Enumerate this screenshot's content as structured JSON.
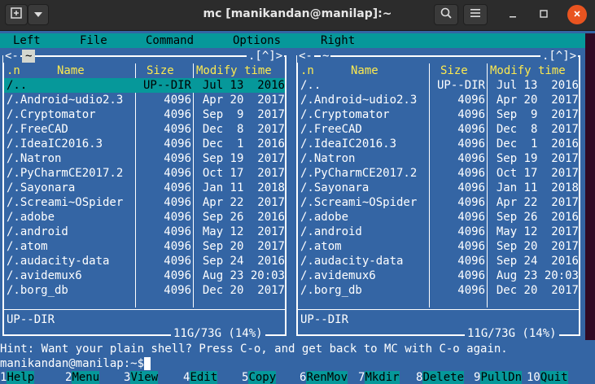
{
  "window": {
    "title": "mc [manikandan@manilap]:~",
    "new_tab_icon": "terminal-add-icon",
    "menu_icon": "chevron-down-icon"
  },
  "menubar": [
    "Left",
    "File",
    "Command",
    "Options",
    "Right"
  ],
  "left_panel": {
    "top_left": "<-",
    "dir": "~",
    "top_right": ".[^]>",
    "headers": {
      "name_prefix": ".n",
      "name": "Name",
      "size": "Size",
      "time": "Modify time"
    },
    "footer_info": "UP--DIR",
    "disk": "11G/73G (14%)"
  },
  "right_panel": {
    "top_left": "<-",
    "dir": "~",
    "top_right": ".[^]>",
    "headers": {
      "name_prefix": ".n",
      "name": "Name",
      "size": "Size",
      "time": "Modify time"
    },
    "footer_info": "UP--DIR",
    "disk": "11G/73G (14%)"
  },
  "files": [
    {
      "name": "/..",
      "size": "UP--DIR",
      "time": "Jul 13  2016"
    },
    {
      "name": "/.Android~udio2.3",
      "size": "4096",
      "time": "Apr 20  2017"
    },
    {
      "name": "/.Cryptomator",
      "size": "4096",
      "time": "Sep  9  2017"
    },
    {
      "name": "/.FreeCAD",
      "size": "4096",
      "time": "Dec  8  2017"
    },
    {
      "name": "/.IdeaIC2016.3",
      "size": "4096",
      "time": "Dec  1  2016"
    },
    {
      "name": "/.Natron",
      "size": "4096",
      "time": "Sep 19  2017"
    },
    {
      "name": "/.PyCharmCE2017.2",
      "size": "4096",
      "time": "Oct 17  2017"
    },
    {
      "name": "/.Sayonara",
      "size": "4096",
      "time": "Jan 11  2018"
    },
    {
      "name": "/.Screami~OSpider",
      "size": "4096",
      "time": "Apr 22  2017"
    },
    {
      "name": "/.adobe",
      "size": "4096",
      "time": "Sep 26  2016"
    },
    {
      "name": "/.android",
      "size": "4096",
      "time": "May 12  2017"
    },
    {
      "name": "/.atom",
      "size": "4096",
      "time": "Sep 20  2017"
    },
    {
      "name": "/.audacity-data",
      "size": "4096",
      "time": "Sep 24  2016"
    },
    {
      "name": "/.avidemux6",
      "size": "4096",
      "time": "Aug 23 20:03"
    },
    {
      "name": "/.borg_db",
      "size": "4096",
      "time": "Dec 20  2017"
    }
  ],
  "hint": "Hint: Want your plain shell? Press C-o, and get back to MC with C-o again.",
  "prompt": "manikandan@manilap:~$",
  "fkeys": [
    {
      "num": "1",
      "label": "Help"
    },
    {
      "num": "2",
      "label": "Menu"
    },
    {
      "num": "3",
      "label": "View"
    },
    {
      "num": "4",
      "label": "Edit"
    },
    {
      "num": "5",
      "label": "Copy"
    },
    {
      "num": "6",
      "label": "RenMov"
    },
    {
      "num": "7",
      "label": "Mkdir"
    },
    {
      "num": "8",
      "label": "Delete"
    },
    {
      "num": "9",
      "label": "PullDn"
    },
    {
      "num": "10",
      "label": "Quit"
    }
  ],
  "colors": {
    "panel_bg": "#3465a4",
    "highlight": "#06989a",
    "header_text": "#fce94f",
    "terminal_bg": "#300a24",
    "close_button": "#e95420"
  }
}
